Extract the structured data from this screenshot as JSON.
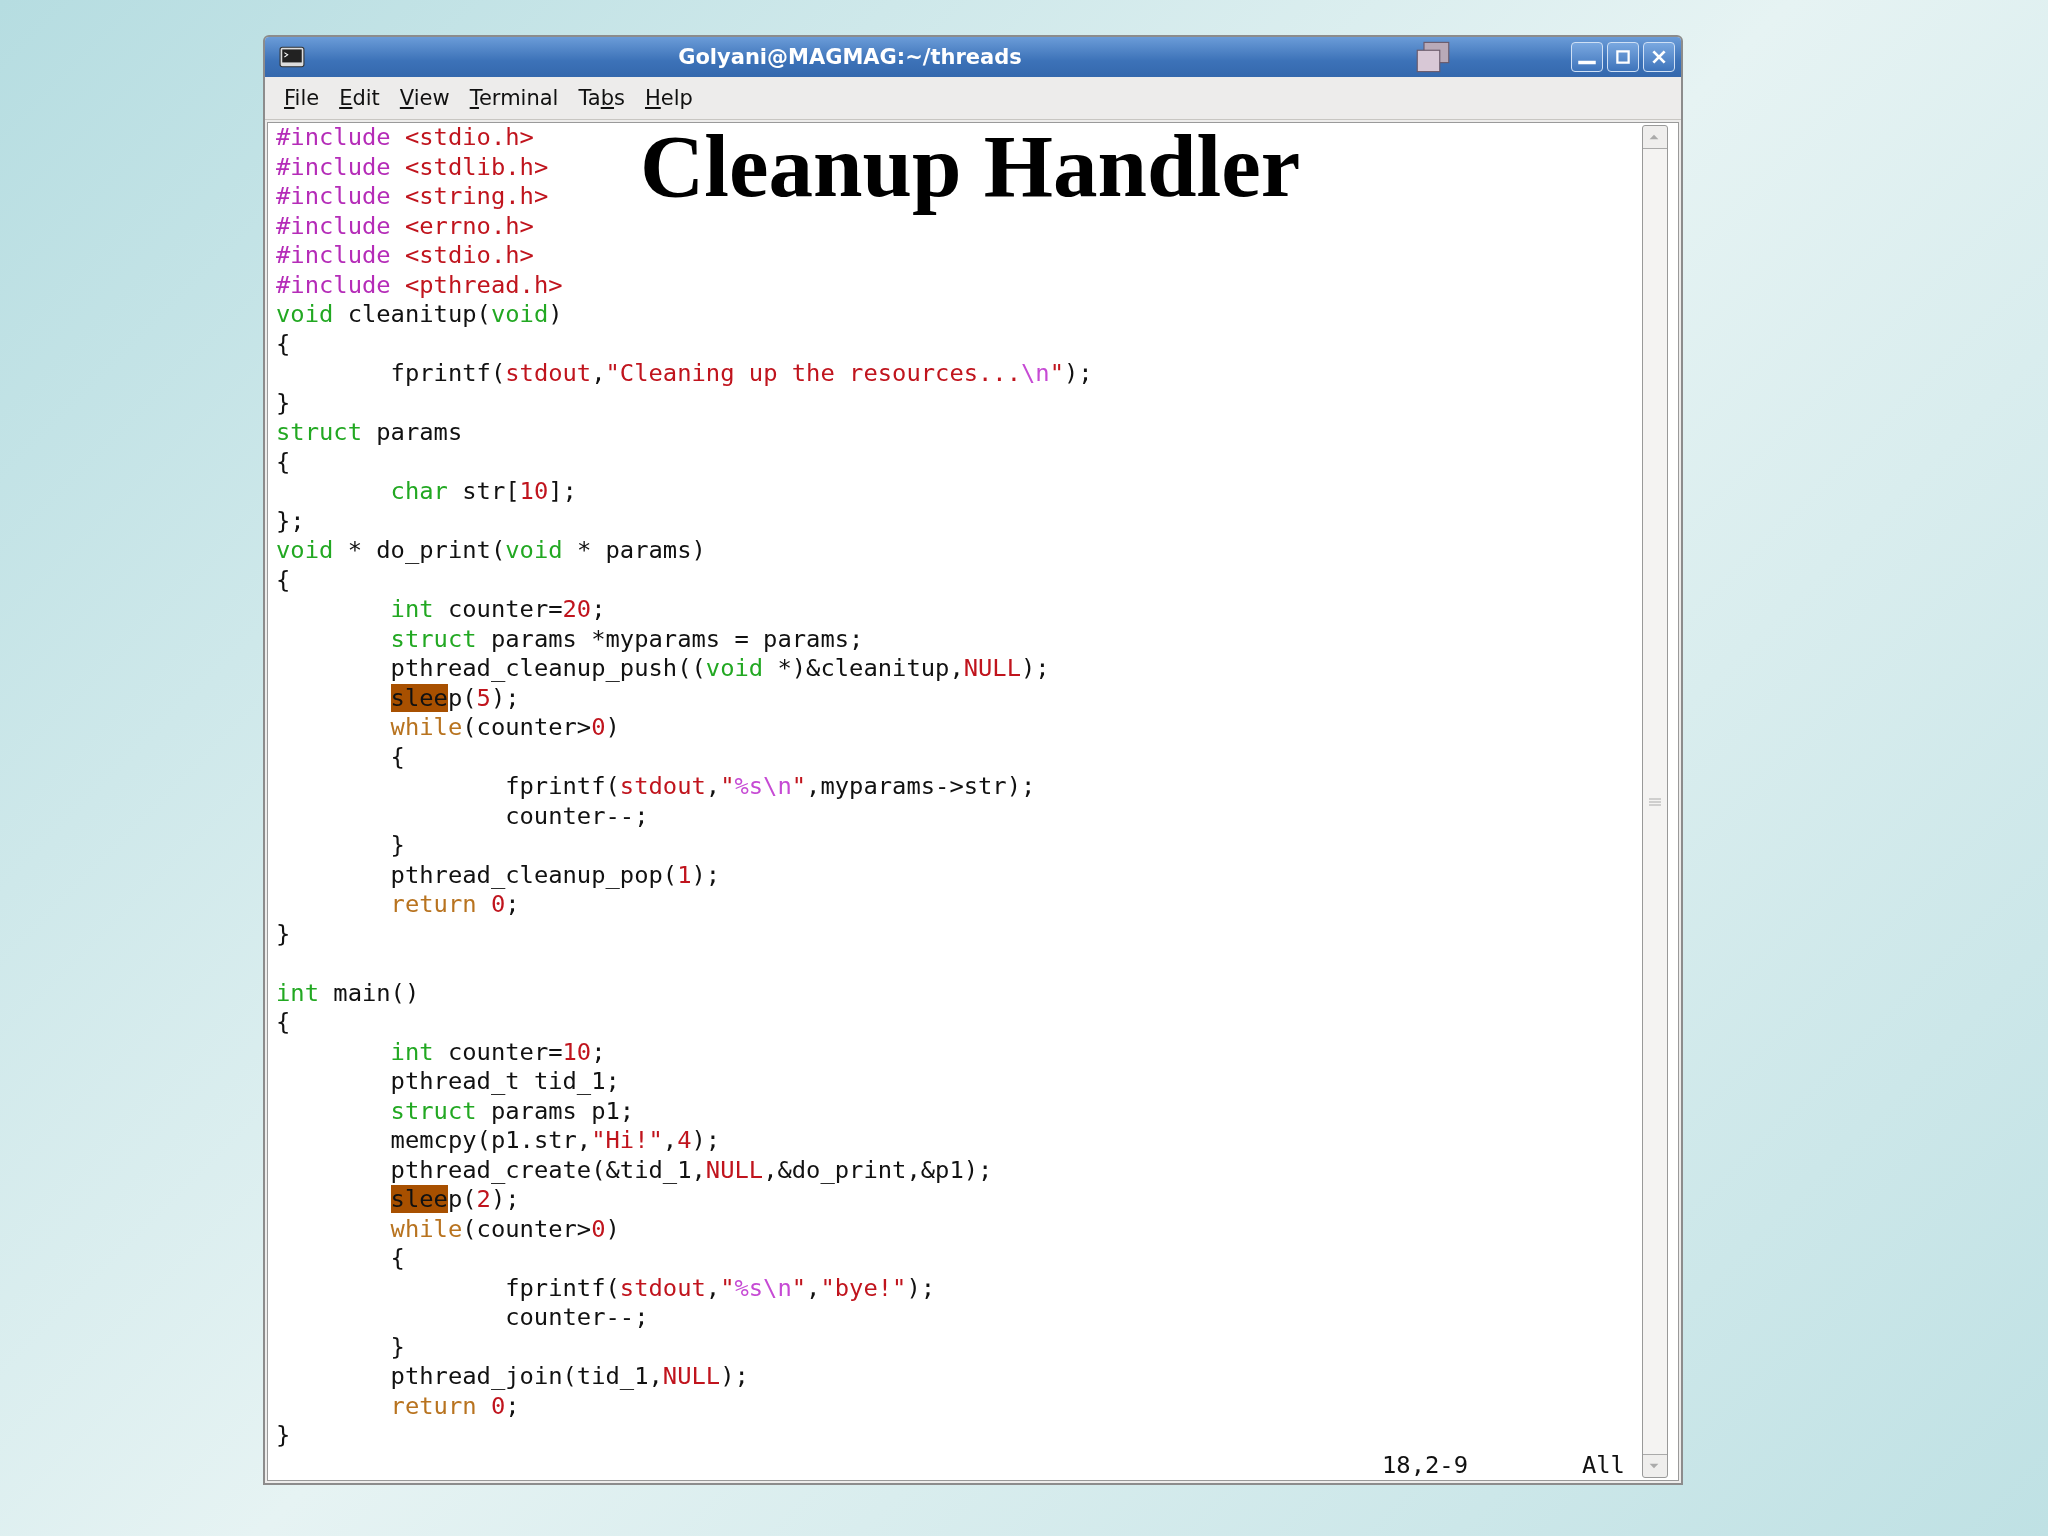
{
  "slide_title": "Cleanup Handler",
  "window": {
    "title": "Golyani@MAGMAG:~/threads"
  },
  "menu": [
    {
      "key": "F",
      "post": "ile"
    },
    {
      "key": "E",
      "post": "dit"
    },
    {
      "key": "V",
      "post": "iew"
    },
    {
      "key": "T",
      "post": "erminal"
    },
    {
      "pre": "Ta",
      "key": "b",
      "post": "s"
    },
    {
      "key": "H",
      "post": "elp"
    }
  ],
  "code": [
    {
      "kind": "top",
      "tokens": [
        {
          "kind": "pre",
          "text": "#include"
        },
        {
          "kind": "str",
          "text": " <stdio.h>"
        }
      ]
    },
    {
      "kind": "top",
      "tokens": [
        {
          "kind": "pre",
          "text": "#include"
        },
        {
          "kind": "str",
          "text": " <stdlib.h>"
        }
      ]
    },
    {
      "kind": "top",
      "tokens": [
        {
          "kind": "pre",
          "text": "#include"
        },
        {
          "kind": "str",
          "text": " <string.h>"
        }
      ]
    },
    {
      "kind": "top",
      "tokens": [
        {
          "kind": "pre",
          "text": "#include"
        },
        {
          "kind": "str",
          "text": " <errno.h>"
        }
      ]
    },
    {
      "kind": "top",
      "tokens": [
        {
          "kind": "pre",
          "text": "#include"
        },
        {
          "kind": "str",
          "text": " <stdio.h>"
        }
      ]
    },
    {
      "kind": "top",
      "tokens": [
        {
          "kind": "pre",
          "text": "#include"
        },
        {
          "kind": "str",
          "text": " <pthread.h>"
        }
      ]
    },
    {
      "kind": "top",
      "tokens": [
        {
          "kind": "type",
          "text": "void"
        },
        {
          "kind": "plain",
          "text": " cleanitup("
        },
        {
          "kind": "type",
          "text": "void"
        },
        {
          "kind": "plain",
          "text": ")"
        }
      ]
    },
    {
      "kind": "top",
      "tokens": [
        {
          "kind": "plain",
          "text": "{"
        }
      ]
    },
    {
      "kind": "inner",
      "tokens": [
        {
          "kind": "plain",
          "text": "fprintf("
        },
        {
          "kind": "str",
          "text": "stdout"
        },
        {
          "kind": "plain",
          "text": ","
        },
        {
          "kind": "str",
          "text": "\"Cleaning up the resources..."
        },
        {
          "kind": "special",
          "text": "\\n"
        },
        {
          "kind": "str",
          "text": "\""
        },
        {
          "kind": "plain",
          "text": ");"
        }
      ]
    },
    {
      "kind": "top",
      "tokens": [
        {
          "kind": "plain",
          "text": "}"
        }
      ]
    },
    {
      "kind": "top",
      "tokens": [
        {
          "kind": "type",
          "text": "struct"
        },
        {
          "kind": "plain",
          "text": " params"
        }
      ]
    },
    {
      "kind": "top",
      "tokens": [
        {
          "kind": "plain",
          "text": "{"
        }
      ]
    },
    {
      "kind": "inner",
      "tokens": [
        {
          "kind": "type",
          "text": "char"
        },
        {
          "kind": "plain",
          "text": " str["
        },
        {
          "kind": "str",
          "text": "10"
        },
        {
          "kind": "plain",
          "text": "];"
        }
      ]
    },
    {
      "kind": "top",
      "tokens": [
        {
          "kind": "plain",
          "text": "};"
        }
      ]
    },
    {
      "kind": "top",
      "tokens": [
        {
          "kind": "type",
          "text": "void"
        },
        {
          "kind": "plain",
          "text": " * do_print("
        },
        {
          "kind": "type",
          "text": "void"
        },
        {
          "kind": "plain",
          "text": " * params)"
        }
      ]
    },
    {
      "kind": "top",
      "tokens": [
        {
          "kind": "plain",
          "text": "{"
        }
      ]
    },
    {
      "kind": "inner",
      "tokens": [
        {
          "kind": "type",
          "text": "int"
        },
        {
          "kind": "plain",
          "text": " counter="
        },
        {
          "kind": "str",
          "text": "20"
        },
        {
          "kind": "plain",
          "text": ";"
        }
      ]
    },
    {
      "kind": "inner",
      "tokens": [
        {
          "kind": "type",
          "text": "struct"
        },
        {
          "kind": "plain",
          "text": " params *myparams = params;"
        }
      ]
    },
    {
      "kind": "inner",
      "tokens": [
        {
          "kind": "plain",
          "text": "pthread_cleanup_push(("
        },
        {
          "kind": "type",
          "text": "void"
        },
        {
          "kind": "plain",
          "text": " *)&cleanitup,"
        },
        {
          "kind": "str",
          "text": "NULL"
        },
        {
          "kind": "plain",
          "text": ");"
        }
      ]
    },
    {
      "kind": "inner",
      "tokens": [
        {
          "kind": "match",
          "text": "slee"
        },
        {
          "kind": "plain",
          "text": "p("
        },
        {
          "kind": "str",
          "text": "5"
        },
        {
          "kind": "plain",
          "text": ");"
        }
      ]
    },
    {
      "kind": "inner",
      "tokens": [
        {
          "kind": "ctrl",
          "text": "while"
        },
        {
          "kind": "plain",
          "text": "(counter>"
        },
        {
          "kind": "str",
          "text": "0"
        },
        {
          "kind": "plain",
          "text": ")"
        }
      ]
    },
    {
      "kind": "inner",
      "tokens": [
        {
          "kind": "plain",
          "text": "{"
        }
      ]
    },
    {
      "kind": "deep",
      "tokens": [
        {
          "kind": "plain",
          "text": "fprintf("
        },
        {
          "kind": "str",
          "text": "stdout"
        },
        {
          "kind": "plain",
          "text": ","
        },
        {
          "kind": "str",
          "text": "\""
        },
        {
          "kind": "special",
          "text": "%s\\n"
        },
        {
          "kind": "str",
          "text": "\""
        },
        {
          "kind": "plain",
          "text": ",myparams->str);"
        }
      ]
    },
    {
      "kind": "deep",
      "tokens": [
        {
          "kind": "plain",
          "text": "counter--;"
        }
      ]
    },
    {
      "kind": "inner",
      "tokens": [
        {
          "kind": "plain",
          "text": "}"
        }
      ]
    },
    {
      "kind": "inner",
      "tokens": [
        {
          "kind": "plain",
          "text": "pthread_cleanup_pop("
        },
        {
          "kind": "str",
          "text": "1"
        },
        {
          "kind": "plain",
          "text": ");"
        }
      ]
    },
    {
      "kind": "inner",
      "tokens": [
        {
          "kind": "ctrl",
          "text": "return"
        },
        {
          "kind": "str",
          "text": " 0"
        },
        {
          "kind": "plain",
          "text": ";"
        }
      ]
    },
    {
      "kind": "top",
      "tokens": [
        {
          "kind": "plain",
          "text": "}"
        }
      ]
    },
    {
      "kind": "top",
      "space_above": true,
      "tokens": [
        {
          "kind": "type",
          "text": "int"
        },
        {
          "kind": "plain",
          "text": " main()"
        }
      ]
    },
    {
      "kind": "top",
      "tokens": [
        {
          "kind": "plain",
          "text": "{"
        }
      ]
    },
    {
      "kind": "inner",
      "tokens": [
        {
          "kind": "type",
          "text": "int"
        },
        {
          "kind": "plain",
          "text": " counter="
        },
        {
          "kind": "str",
          "text": "10"
        },
        {
          "kind": "plain",
          "text": ";"
        }
      ]
    },
    {
      "kind": "inner",
      "tokens": [
        {
          "kind": "plain",
          "text": "pthread_t tid_1;"
        }
      ]
    },
    {
      "kind": "inner",
      "tokens": [
        {
          "kind": "type",
          "text": "struct"
        },
        {
          "kind": "plain",
          "text": " params p1;"
        }
      ]
    },
    {
      "kind": "inner",
      "tokens": [
        {
          "kind": "plain",
          "text": "memcpy(p1.str,"
        },
        {
          "kind": "str",
          "text": "\"Hi!\""
        },
        {
          "kind": "plain",
          "text": ","
        },
        {
          "kind": "str",
          "text": "4"
        },
        {
          "kind": "plain",
          "text": ");"
        }
      ]
    },
    {
      "kind": "inner",
      "tokens": [
        {
          "kind": "plain",
          "text": "pthread_create(&tid_1,"
        },
        {
          "kind": "str",
          "text": "NULL"
        },
        {
          "kind": "plain",
          "text": ",&do_print,&p1);"
        }
      ]
    },
    {
      "kind": "inner",
      "tokens": [
        {
          "kind": "match",
          "text": "slee"
        },
        {
          "kind": "plain",
          "text": "p("
        },
        {
          "kind": "str",
          "text": "2"
        },
        {
          "kind": "plain",
          "text": ");"
        }
      ]
    },
    {
      "kind": "inner",
      "tokens": [
        {
          "kind": "ctrl",
          "text": "while"
        },
        {
          "kind": "plain",
          "text": "(counter>"
        },
        {
          "kind": "str",
          "text": "0"
        },
        {
          "kind": "plain",
          "text": ")"
        }
      ]
    },
    {
      "kind": "inner",
      "tokens": [
        {
          "kind": "plain",
          "text": "{"
        }
      ]
    },
    {
      "kind": "deep",
      "tokens": [
        {
          "kind": "plain",
          "text": "fprintf("
        },
        {
          "kind": "str",
          "text": "stdout"
        },
        {
          "kind": "plain",
          "text": ","
        },
        {
          "kind": "str",
          "text": "\""
        },
        {
          "kind": "special",
          "text": "%s\\n"
        },
        {
          "kind": "str",
          "text": "\""
        },
        {
          "kind": "plain",
          "text": ","
        },
        {
          "kind": "str",
          "text": "\"bye!\""
        },
        {
          "kind": "plain",
          "text": ");"
        }
      ]
    },
    {
      "kind": "deep",
      "tokens": [
        {
          "kind": "plain",
          "text": "counter--;"
        }
      ]
    },
    {
      "kind": "inner",
      "tokens": [
        {
          "kind": "plain",
          "text": "}"
        }
      ]
    },
    {
      "kind": "inner",
      "tokens": [
        {
          "kind": "plain",
          "text": "pthread_join(tid_1,"
        },
        {
          "kind": "str",
          "text": "NULL"
        },
        {
          "kind": "plain",
          "text": ");"
        }
      ]
    },
    {
      "kind": "inner",
      "tokens": [
        {
          "kind": "ctrl",
          "text": "return"
        },
        {
          "kind": "str",
          "text": " 0"
        },
        {
          "kind": "plain",
          "text": ";"
        }
      ]
    },
    {
      "kind": "top",
      "tokens": [
        {
          "kind": "plain",
          "text": "}"
        }
      ]
    }
  ],
  "status": {
    "position": "18,2-9",
    "scroll": "All"
  }
}
